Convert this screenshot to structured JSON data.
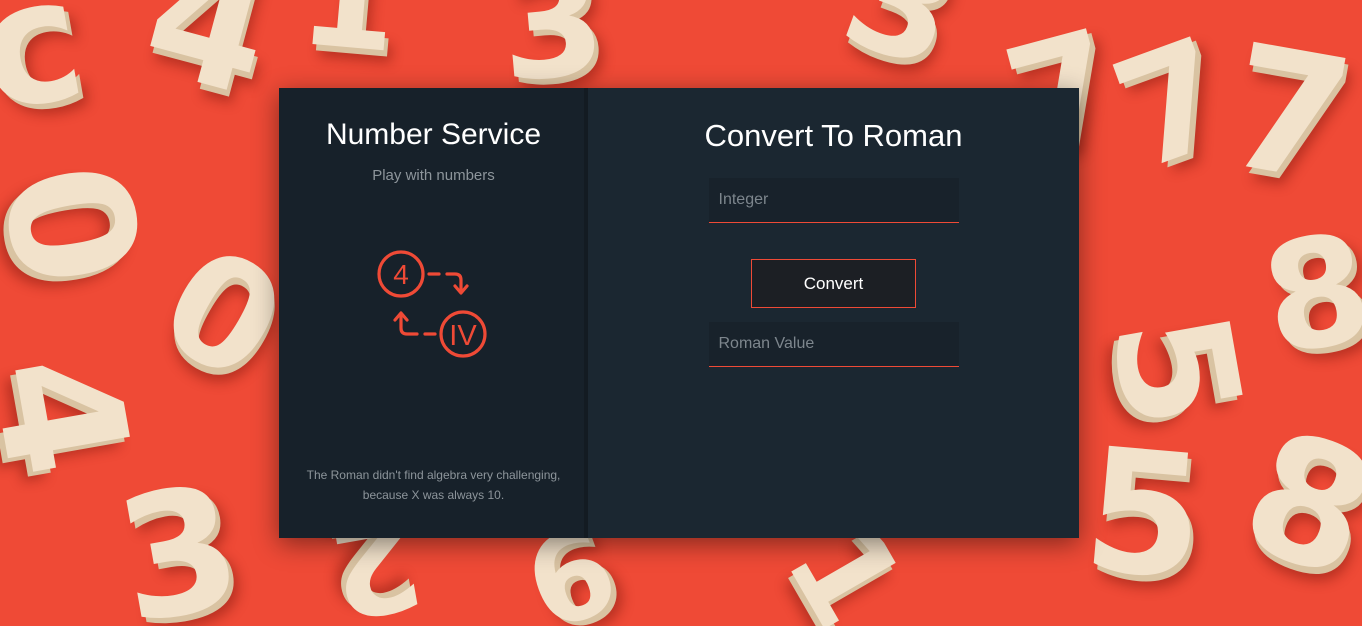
{
  "background": {
    "digits": [
      "c",
      "4",
      "1",
      "3",
      "3",
      "0",
      "0",
      "4",
      "3",
      "7",
      "7",
      "7",
      "5",
      "5",
      "8",
      "8",
      "2",
      "1",
      "6"
    ]
  },
  "left_panel": {
    "title": "Number Service",
    "subtitle": "Play with numbers",
    "logo": {
      "icon": "number-to-roman-icon",
      "number_text": "4",
      "roman_text": "IV"
    },
    "joke": "The Roman didn't find algebra very challenging, because X was always 10."
  },
  "right_panel": {
    "title": "Convert To Roman",
    "integer_input": {
      "placeholder": "Integer",
      "value": ""
    },
    "convert_button": {
      "label": "Convert"
    },
    "roman_output": {
      "placeholder": "Roman Value",
      "value": ""
    }
  },
  "colors": {
    "accent": "#ef4a36",
    "left_panel_bg": "#17212a",
    "right_panel_bg": "#1b2731",
    "page_bg": "#ef4a36",
    "number_tile": "#f2e2cb"
  }
}
